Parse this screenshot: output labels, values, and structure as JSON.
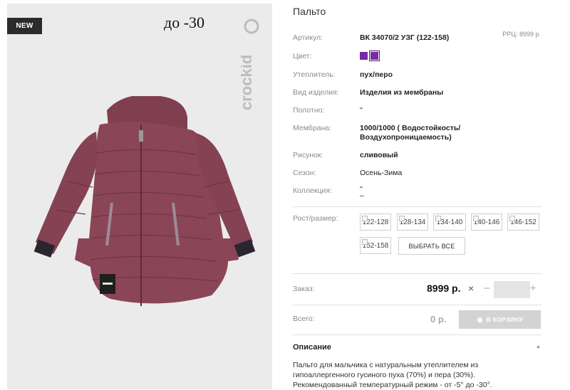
{
  "product": {
    "badge": "NEW",
    "temperature_note": "до -30",
    "brand": "crockid",
    "title": "Пальто"
  },
  "specs": {
    "article_label": "Артикул:",
    "article_value": "ВК 34070/2 УЗГ (122-158)",
    "rrc": "РРЦ: 8999 р.",
    "color_label": "Цвет:",
    "color_swatches": [
      "#7a2aa8",
      "#7a2aa8"
    ],
    "insulation_label": "Утеплитель:",
    "insulation_value": "пух/перо",
    "type_label": "Вид изделия:",
    "type_value": "Изделия из мембраны",
    "fabric_label": "Полотно:",
    "fabric_value": "\"",
    "membrane_label": "Мембрана:",
    "membrane_value_1": "1000/1000 ( Водостойкость/",
    "membrane_value_2": "Воздухопроницаемость)",
    "pattern_label": "Рисунок:",
    "pattern_value": "сливовый",
    "season_label": "Сезон:",
    "season_value": "Осень-Зима",
    "collection_label": "Коллекция:",
    "collection_value_1": "\"",
    "collection_value_2": "–"
  },
  "sizes": {
    "label": "Рост/размер:",
    "options": [
      "122-128",
      "128-134",
      "134-140",
      "140-146",
      "146-152",
      "152-158"
    ],
    "select_all": "ВЫБРАТЬ ВСЕ"
  },
  "order": {
    "label": "Заказ:",
    "price": "8999 р.",
    "times": "×",
    "minus": "–",
    "plus": "+",
    "qty_value": ""
  },
  "total": {
    "label": "Всего:",
    "value": "0 р.",
    "cart_button": "В КОРЗИНУ"
  },
  "description": {
    "heading": "Описание",
    "text_1": "Пальто для мальчика с натуральным утеплителем из",
    "text_2": "гипоаллергенного гусиного пуха (70%) и пера (30%).",
    "text_3": "Рекомендованный температурный режим - от -5° до -30°."
  }
}
